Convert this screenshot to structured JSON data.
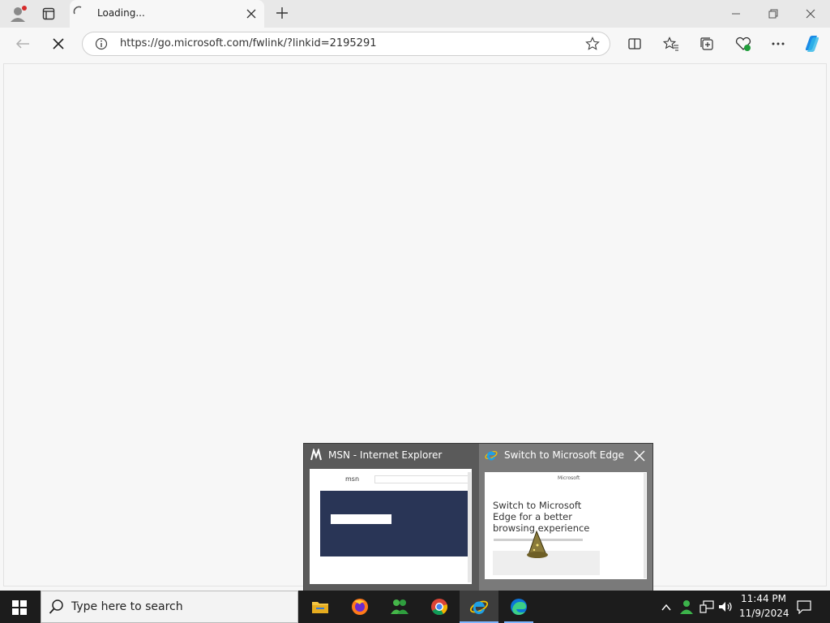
{
  "browser": {
    "tab": {
      "title": "Loading..."
    },
    "address_bar": {
      "url": "https://go.microsoft.com/fwlink/?linkid=2195291"
    }
  },
  "taskbar": {
    "search_placeholder": "Type here to search",
    "clock": {
      "time": "11:44 PM",
      "date": "11/9/2024"
    }
  },
  "preview": {
    "items": [
      {
        "title": "MSN - Internet Explorer",
        "thumb_text": "msn"
      },
      {
        "title": "Switch to Microsoft Edge ...",
        "thumb_brand": "Microsoft",
        "thumb_heading": "Switch to Microsoft Edge for a better browsing experience"
      }
    ]
  },
  "colors": {
    "taskbar": "#1c1c1c",
    "preview_bg": "#3b3b3b",
    "msn_banner": "#293556",
    "edge_blue": "#0b74d8"
  }
}
